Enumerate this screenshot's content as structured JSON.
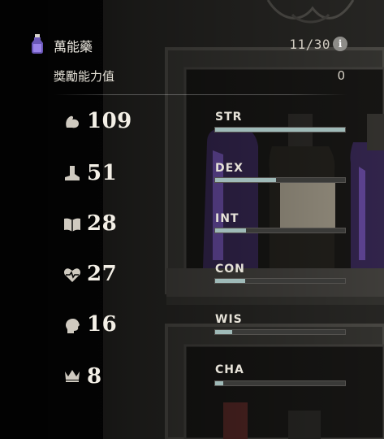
{
  "header": {
    "potion_title": "萬能藥",
    "potion_count": "11/30",
    "info_glyph": "i",
    "bonus_label": "獎勵能力值",
    "bonus_value": "0"
  },
  "stats": [
    {
      "key": "str",
      "value": "109",
      "label": "STR",
      "fill": 1.0,
      "icon": "strength-arm-icon"
    },
    {
      "key": "dex",
      "value": "51",
      "label": "DEX",
      "fill": 0.47,
      "icon": "boot-icon"
    },
    {
      "key": "int",
      "value": "28",
      "label": "INT",
      "fill": 0.24,
      "icon": "book-icon"
    },
    {
      "key": "con",
      "value": "27",
      "label": "CON",
      "fill": 0.23,
      "icon": "heart-pulse-icon"
    },
    {
      "key": "wis",
      "value": "16",
      "label": "WIS",
      "fill": 0.13,
      "icon": "head-icon"
    },
    {
      "key": "cha",
      "value": "8",
      "label": "CHA",
      "fill": 0.06,
      "icon": "crown-icon"
    }
  ],
  "colors": {
    "bar_fill": "#9fbab8",
    "bar_track": "#3a3a38",
    "potion_glow": "#8a64d8"
  }
}
